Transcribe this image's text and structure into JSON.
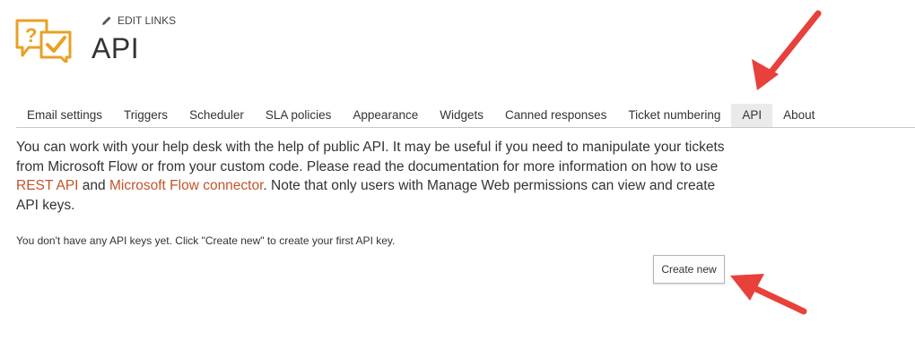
{
  "header": {
    "edit_links": "EDIT LINKS",
    "title": "API"
  },
  "tabs": [
    {
      "label": "Email settings"
    },
    {
      "label": "Triggers"
    },
    {
      "label": "Scheduler"
    },
    {
      "label": "SLA policies"
    },
    {
      "label": "Appearance"
    },
    {
      "label": "Widgets"
    },
    {
      "label": "Canned responses"
    },
    {
      "label": "Ticket numbering"
    },
    {
      "label": "API",
      "active": true
    },
    {
      "label": "About"
    }
  ],
  "content": {
    "para_before_link1": "You can work with your help desk with the help of public API. It may be useful if you need to manipulate your tickets from Microsoft Flow or from your custom code. Please read the documentation for more information on how to use ",
    "link_rest": "REST API",
    "para_between": " and ",
    "link_flow": "Microsoft Flow connector",
    "para_after": ". Note that only users with Manage Web permissions can view and create API keys.",
    "no_keys_note": "You don't have any API keys yet. Click \"Create new\" to create your first API key.",
    "create_button": "Create new"
  },
  "colors": {
    "link": "#c1542b",
    "arrow": "#e8403a",
    "logo": "#e8a124"
  },
  "icons": {
    "logo": "question-check-bubbles-icon",
    "edit": "pencil-icon"
  }
}
